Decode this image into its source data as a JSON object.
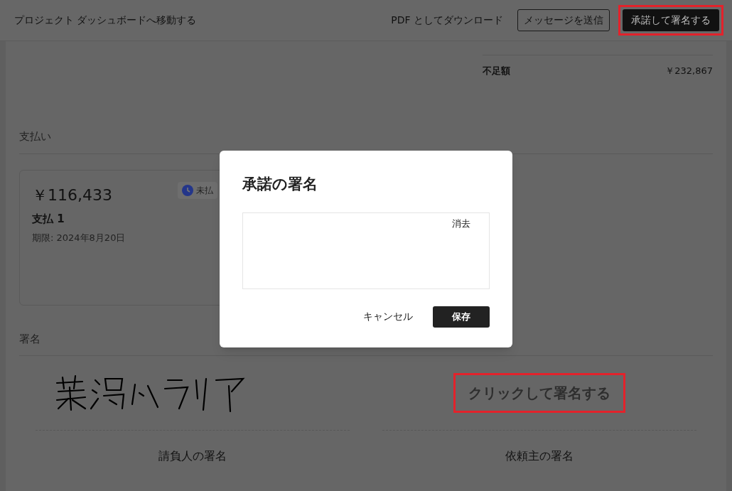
{
  "header": {
    "back_link": "プロジェクト ダッシュボードへ移動する",
    "actions": [
      {
        "label": "PDF としてダウンロード",
        "kind": "link",
        "highlighted": false
      },
      {
        "label": "メッセージを送信",
        "kind": "outline",
        "highlighted": false
      },
      {
        "label": "承諾して署名する",
        "kind": "primary",
        "highlighted": true
      }
    ]
  },
  "summary": {
    "label": "不足額",
    "value": "￥232,867"
  },
  "payments": {
    "title": "支払い",
    "cards": [
      {
        "amount": "￥116,433",
        "status": "未払",
        "name": "支払 1",
        "due": "期限: 2024年8月20日"
      }
    ]
  },
  "signatures": {
    "title": "署名",
    "slots": [
      {
        "kind": "signed",
        "caption": "請負人の署名",
        "highlighted": false
      },
      {
        "kind": "empty",
        "prompt": "クリックして署名する",
        "caption": "依頼主の署名",
        "highlighted": true
      }
    ]
  },
  "dialog": {
    "title": "承諾の署名",
    "clear": "消去",
    "cancel": "キャンセル",
    "save": "保存"
  }
}
